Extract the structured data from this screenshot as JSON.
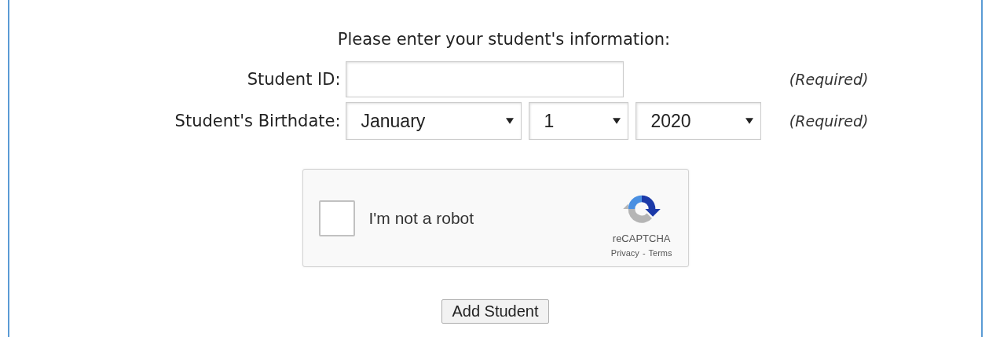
{
  "heading": "Please enter your student's information:",
  "fields": [
    {
      "kind": "text",
      "label": "Student ID:",
      "note": "(Required)"
    },
    {
      "kind": "date",
      "label": "Student's Birthdate:",
      "note": "(Required)",
      "selects": [
        {
          "value": "January"
        },
        {
          "value": "1"
        },
        {
          "value": "2020"
        }
      ]
    }
  ],
  "captcha": {
    "checked": false,
    "label": "I'm not a robot",
    "brand": "reCAPTCHA",
    "links": [
      "Privacy",
      "Terms"
    ],
    "separator": "-"
  },
  "submit": "Add Student"
}
